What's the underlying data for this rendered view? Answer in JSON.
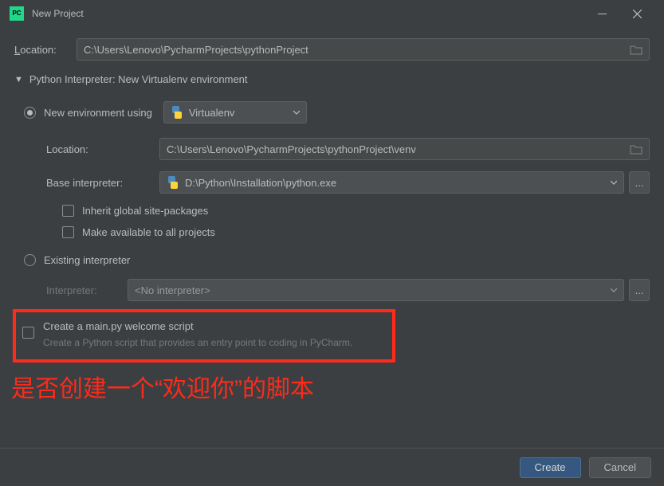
{
  "window": {
    "title": "New Project"
  },
  "location": {
    "label": "Location:",
    "value": "C:\\Users\\Lenovo\\PycharmProjects\\pythonProject"
  },
  "interpreter_section": {
    "header": "Python Interpreter: New Virtualenv environment",
    "new_env_label": "New environment using",
    "virtualenv_label": "Virtualenv",
    "env_location_label": "Location:",
    "env_location_value": "C:\\Users\\Lenovo\\PycharmProjects\\pythonProject\\venv",
    "base_interpreter_label": "Base interpreter:",
    "base_interpreter_value": "D:\\Python\\Installation\\python.exe",
    "inherit_label": "Inherit global site-packages",
    "make_available_label": "Make available to all projects",
    "existing_label": "Existing interpreter",
    "interpreter_label": "Interpreter:",
    "interpreter_value": "<No interpreter>"
  },
  "welcome": {
    "label": "Create a main.py welcome script",
    "hint": "Create a Python script that provides an entry point to coding in PyCharm."
  },
  "annotation": "是否创建一个“欢迎你”的脚本",
  "footer": {
    "create": "Create",
    "cancel": "Cancel"
  },
  "icons": {
    "ellipsis": "..."
  }
}
